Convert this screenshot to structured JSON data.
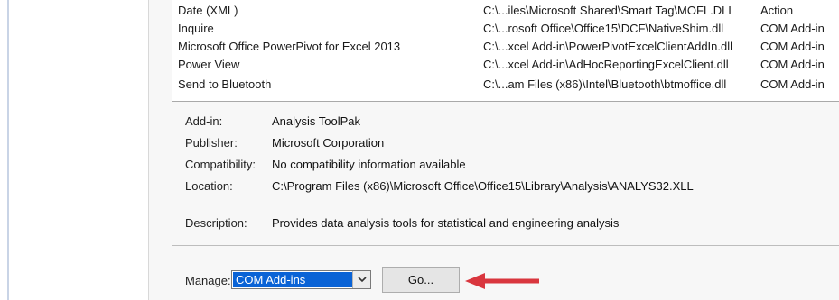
{
  "addins_list": {
    "rows": [
      {
        "name": "Date (XML)",
        "location": "C:\\...iles\\Microsoft Shared\\Smart Tag\\MOFL.DLL",
        "type": "Action"
      },
      {
        "name": "Inquire",
        "location": "C:\\...rosoft Office\\Office15\\DCF\\NativeShim.dll",
        "type": "COM Add-in"
      },
      {
        "name": "Microsoft Office PowerPivot for Excel 2013",
        "location": "C:\\...xcel Add-in\\PowerPivotExcelClientAddIn.dll",
        "type": "COM Add-in"
      },
      {
        "name": "Power View",
        "location": "C:\\...xcel Add-in\\AdHocReportingExcelClient.dll",
        "type": "COM Add-in"
      },
      {
        "name": "Send to Bluetooth",
        "location": "C:\\...am Files (x86)\\Intel\\Bluetooth\\btmoffice.dll",
        "type": "COM Add-in"
      }
    ]
  },
  "details": {
    "addin_label": "Add-in:",
    "addin_value": "Analysis ToolPak",
    "publisher_label": "Publisher:",
    "publisher_value": "Microsoft Corporation",
    "compatibility_label": "Compatibility:",
    "compatibility_value": "No compatibility information available",
    "location_label": "Location:",
    "location_value": "C:\\Program Files (x86)\\Microsoft Office\\Office15\\Library\\Analysis\\ANALYS32.XLL",
    "description_label": "Description:",
    "description_value": "Provides data analysis tools for statistical and engineering analysis"
  },
  "manage": {
    "label": "Manage:",
    "selected": "COM Add-ins",
    "go_label": "Go..."
  },
  "colors": {
    "selection": "#0a63d6",
    "arrow": "#d9363e"
  },
  "icons": {
    "dropdown": "chevron-down-icon",
    "pointer": "arrow-left-icon"
  }
}
